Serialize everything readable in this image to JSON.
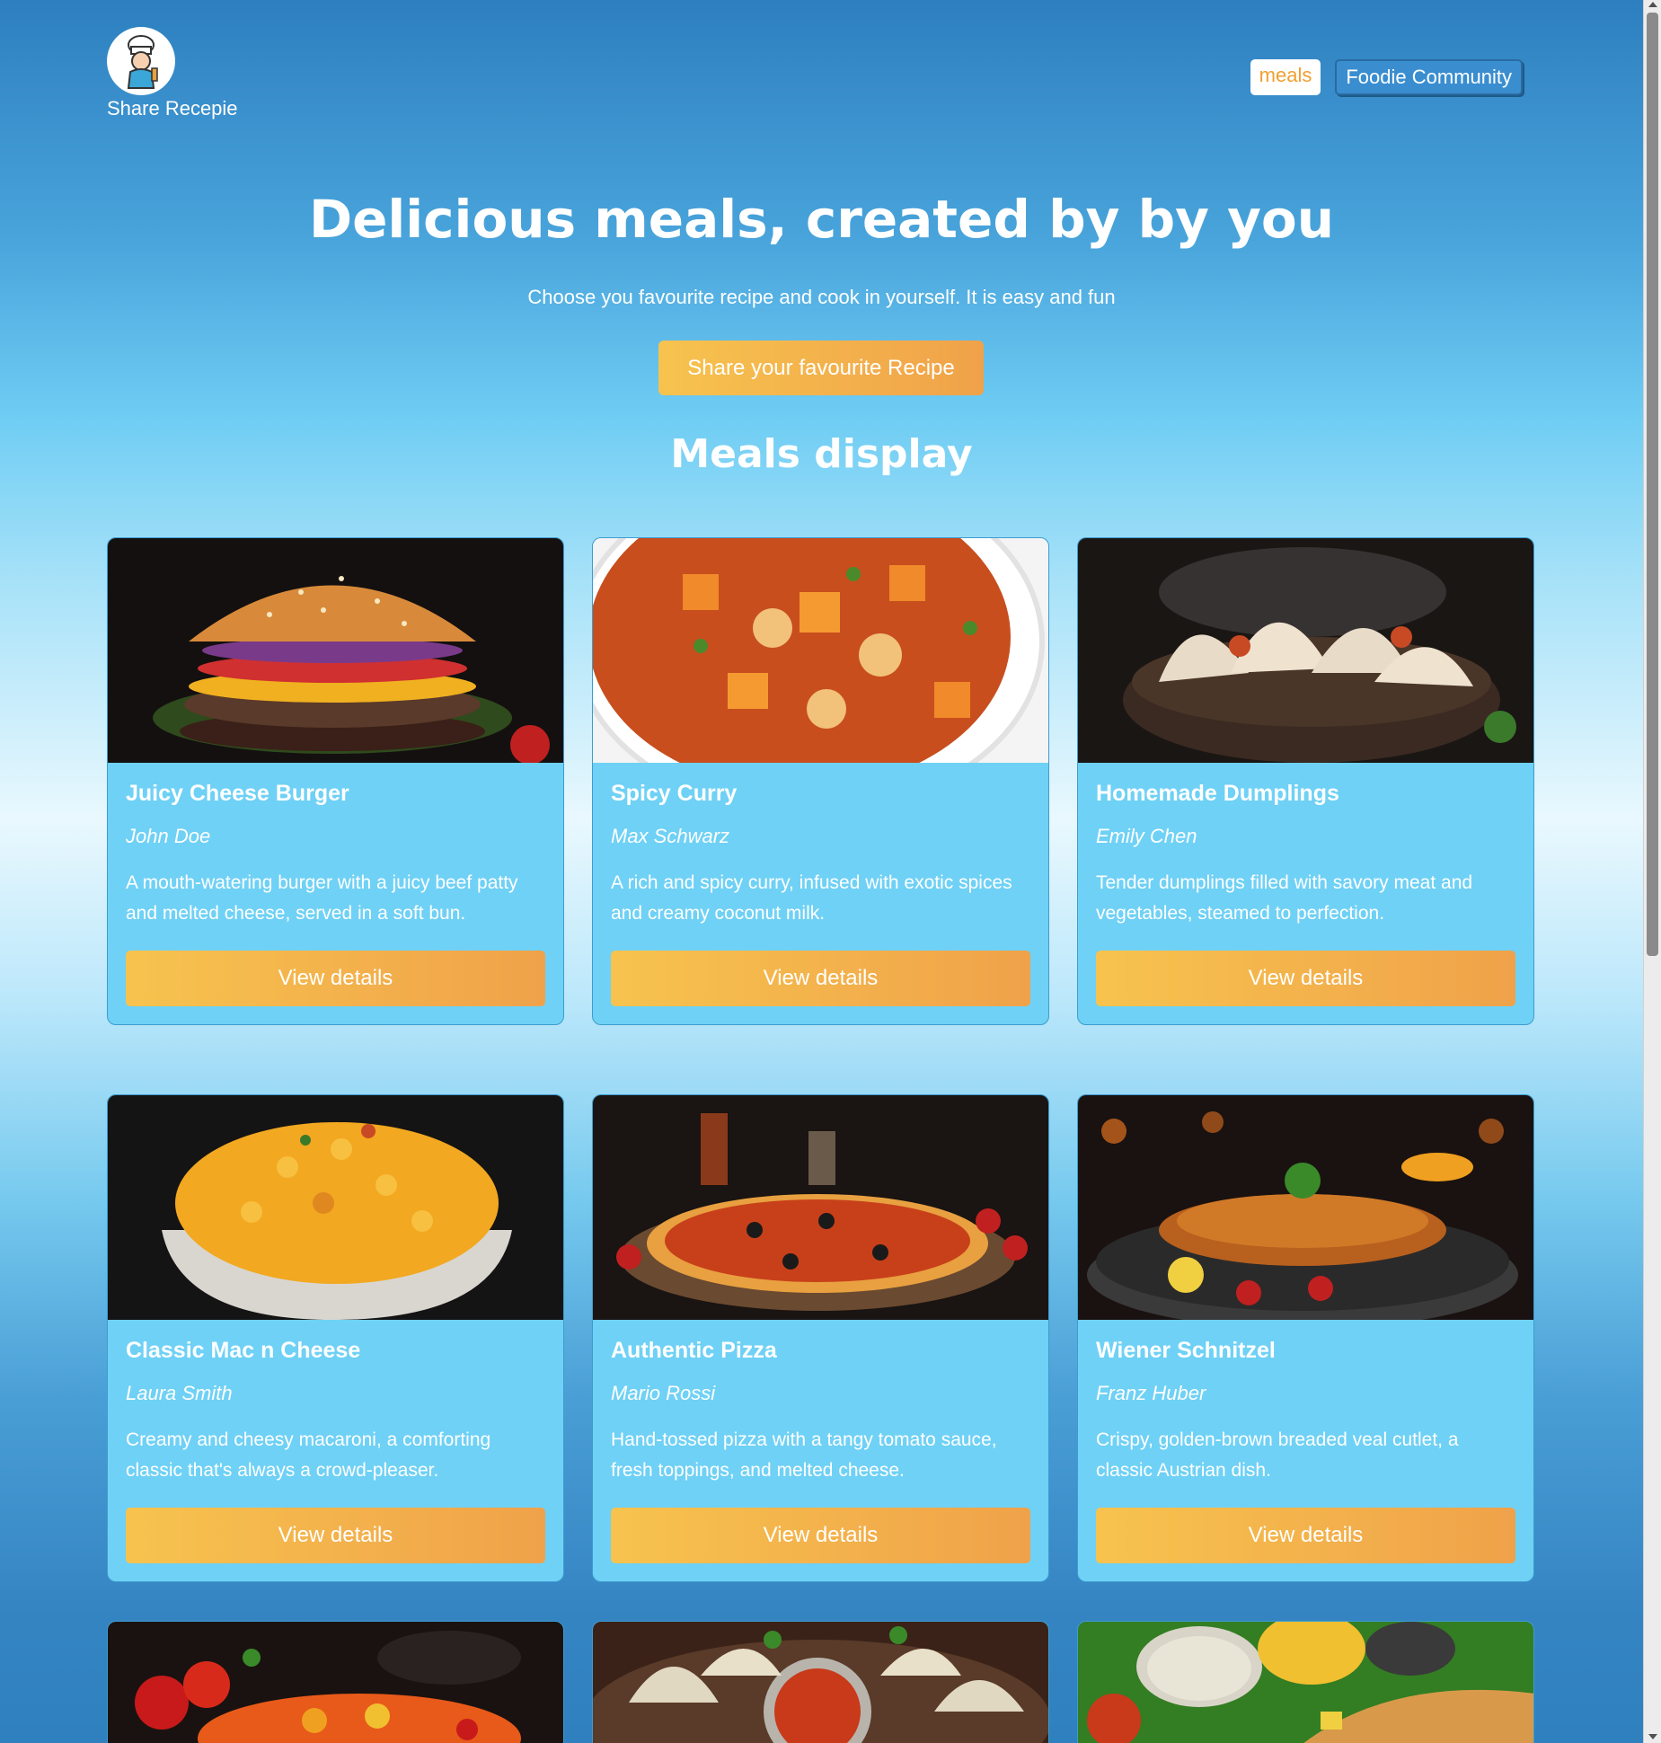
{
  "header": {
    "brand": "Share Recepie",
    "nav": [
      {
        "label": "meals"
      },
      {
        "label": "Foodie Community"
      }
    ]
  },
  "hero": {
    "title": "Delicious meals, created by by you",
    "subtitle": "Choose you favourite recipe and cook in yourself. It is easy and fun",
    "cta": "Share your favourite Recipe"
  },
  "section_title": "Meals display",
  "meals": [
    {
      "title": "Juicy Cheese Burger",
      "author": "John Doe",
      "description": "A mouth-watering burger with a juicy beef patty and melted cheese, served in a soft bun.",
      "button": "View details"
    },
    {
      "title": "Spicy Curry",
      "author": "Max Schwarz",
      "description": "A rich and spicy curry, infused with exotic spices and creamy coconut milk.",
      "button": "View details"
    },
    {
      "title": "Homemade Dumplings",
      "author": "Emily Chen",
      "description": "Tender dumplings filled with savory meat and vegetables, steamed to perfection.",
      "button": "View details"
    },
    {
      "title": "Classic Mac n Cheese",
      "author": "Laura Smith",
      "description": "Creamy and cheesy macaroni, a comforting classic that's always a crowd-pleaser.",
      "button": "View details"
    },
    {
      "title": "Authentic Pizza",
      "author": "Mario Rossi",
      "description": "Hand-tossed pizza with a tangy tomato sauce, fresh toppings, and melted cheese.",
      "button": "View details"
    },
    {
      "title": "Wiener Schnitzel",
      "author": "Franz Huber",
      "description": "Crispy, golden-brown breaded veal cutlet, a classic Austrian dish.",
      "button": "View details"
    }
  ],
  "colors": {
    "accent_orange": "#f0a24a",
    "accent_yellow": "#f7c34e",
    "card_bg": "#6fd1f5"
  }
}
